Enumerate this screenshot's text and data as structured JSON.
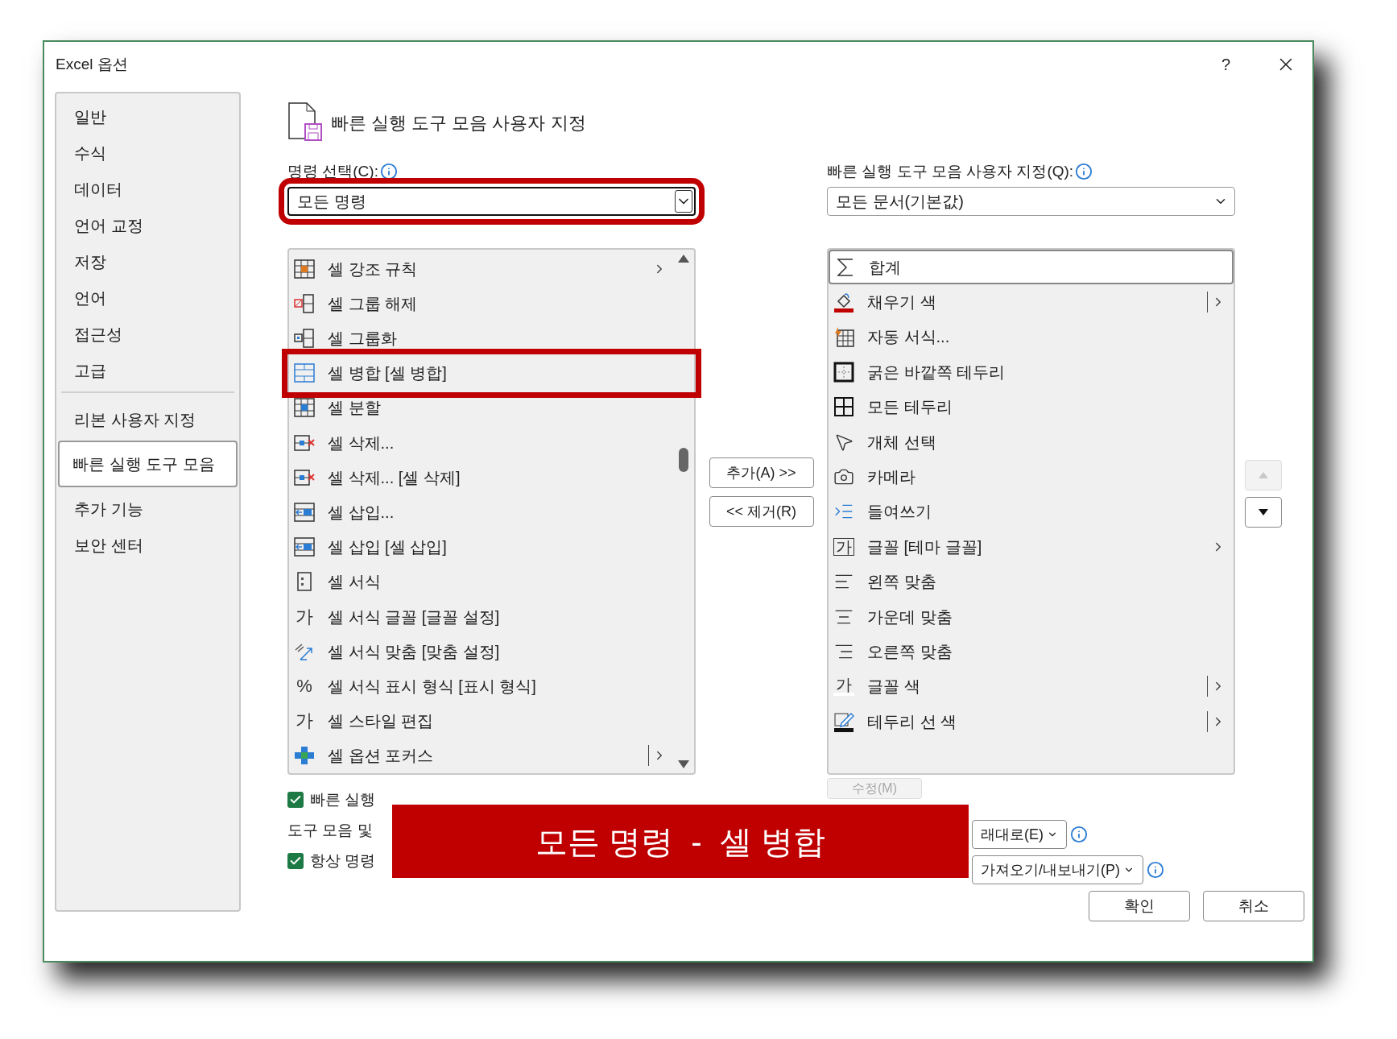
{
  "window": {
    "title": "Excel 옵션",
    "help": "?"
  },
  "sidebar": {
    "groups": [
      [
        {
          "label": "일반",
          "selected": false
        },
        {
          "label": "수식",
          "selected": false
        },
        {
          "label": "데이터",
          "selected": false
        },
        {
          "label": "언어 교정",
          "selected": false
        },
        {
          "label": "저장",
          "selected": false
        },
        {
          "label": "언어",
          "selected": false
        },
        {
          "label": "접근성",
          "selected": false
        },
        {
          "label": "고급",
          "selected": false
        }
      ],
      [
        {
          "label": "리본 사용자 지정",
          "selected": false
        },
        {
          "label": "빠른 실행 도구 모음",
          "selected": true
        },
        {
          "label": "추가 기능",
          "selected": false
        },
        {
          "label": "보안 센터",
          "selected": false
        }
      ]
    ]
  },
  "header": {
    "title": "빠른 실행 도구 모음 사용자 지정"
  },
  "commands": {
    "label": "명령 선택(C):",
    "dropdown": {
      "value": "모든 명령",
      "highlighted": true
    },
    "items": [
      {
        "label": "셀 강조 규칙",
        "kind": "submenu",
        "highlighted": false
      },
      {
        "label": "셀 그룹 해제",
        "highlighted": false
      },
      {
        "label": "셀 그룹화",
        "highlighted": false
      },
      {
        "label": "셀 병합 [셀 병합]",
        "highlighted": true
      },
      {
        "label": "셀 분할",
        "highlighted": false
      },
      {
        "label": "셀 삭제...",
        "highlighted": false
      },
      {
        "label": "셀 삭제... [셀 삭제]",
        "highlighted": false
      },
      {
        "label": "셀 삽입...",
        "highlighted": false
      },
      {
        "label": "셀 삽입 [셀 삽입]",
        "highlighted": false
      },
      {
        "label": "셀 서식",
        "highlighted": false
      },
      {
        "label": "셀 서식 글꼴 [글꼴 설정]",
        "icon_text": "가",
        "highlighted": false
      },
      {
        "label": "셀 서식 맞춤 [맞춤 설정]",
        "highlighted": false
      },
      {
        "label": "셀 서식 표시 형식 [표시 형식]",
        "icon_text": "%",
        "highlighted": false
      },
      {
        "label": "셀 스타일 편집",
        "icon_text": "가",
        "highlighted": false
      },
      {
        "label": "셀 옵션 포커스",
        "kind": "split",
        "highlighted": false
      }
    ]
  },
  "transfer": {
    "add": "추가(A) >>",
    "remove": "<< 제거(R)"
  },
  "toolbar": {
    "label": "빠른 실행 도구 모음 사용자 지정(Q):",
    "dropdown": {
      "value": "모든 문서(기본값)"
    },
    "items": [
      {
        "label": "합계",
        "selected": true
      },
      {
        "label": "채우기 색",
        "kind": "split",
        "selected": false
      },
      {
        "label": "자동 서식...",
        "selected": false
      },
      {
        "label": "굵은 바깥쪽 테두리",
        "selected": false
      },
      {
        "label": "모든 테두리",
        "selected": false
      },
      {
        "label": "개체 선택",
        "selected": false
      },
      {
        "label": "카메라",
        "selected": false
      },
      {
        "label": "들여쓰기",
        "selected": false
      },
      {
        "label": "글꼴 [테마 글꼴]",
        "icon_text": "가",
        "kind": "submenu",
        "selected": false
      },
      {
        "label": "왼쪽 맞춤",
        "selected": false
      },
      {
        "label": "가운데 맞춤",
        "selected": false
      },
      {
        "label": "오른쪽 맞춤",
        "selected": false
      },
      {
        "label": "글꼴 색",
        "icon_text": "가",
        "kind": "split",
        "selected": false
      },
      {
        "label": "테두리 선 색",
        "kind": "split",
        "selected": false
      }
    ],
    "move_up": {
      "disabled": true
    },
    "move_down": {
      "disabled": false
    }
  },
  "options": [
    {
      "kind": "checkbox",
      "label": "빠른 실행",
      "checked": true
    },
    {
      "kind": "text",
      "label": "도구 모음 및"
    },
    {
      "kind": "checkbox",
      "label": "항상 명령",
      "checked": true
    }
  ],
  "modify": {
    "label": "수정(M)",
    "disabled": true
  },
  "customizations": {
    "reset": "래대로(E)",
    "import_export": "가져오기/내보내기(P)"
  },
  "footer": {
    "ok": "확인",
    "cancel": "취소"
  },
  "banner": {
    "text": "모든 명령  -  셀 병합"
  }
}
